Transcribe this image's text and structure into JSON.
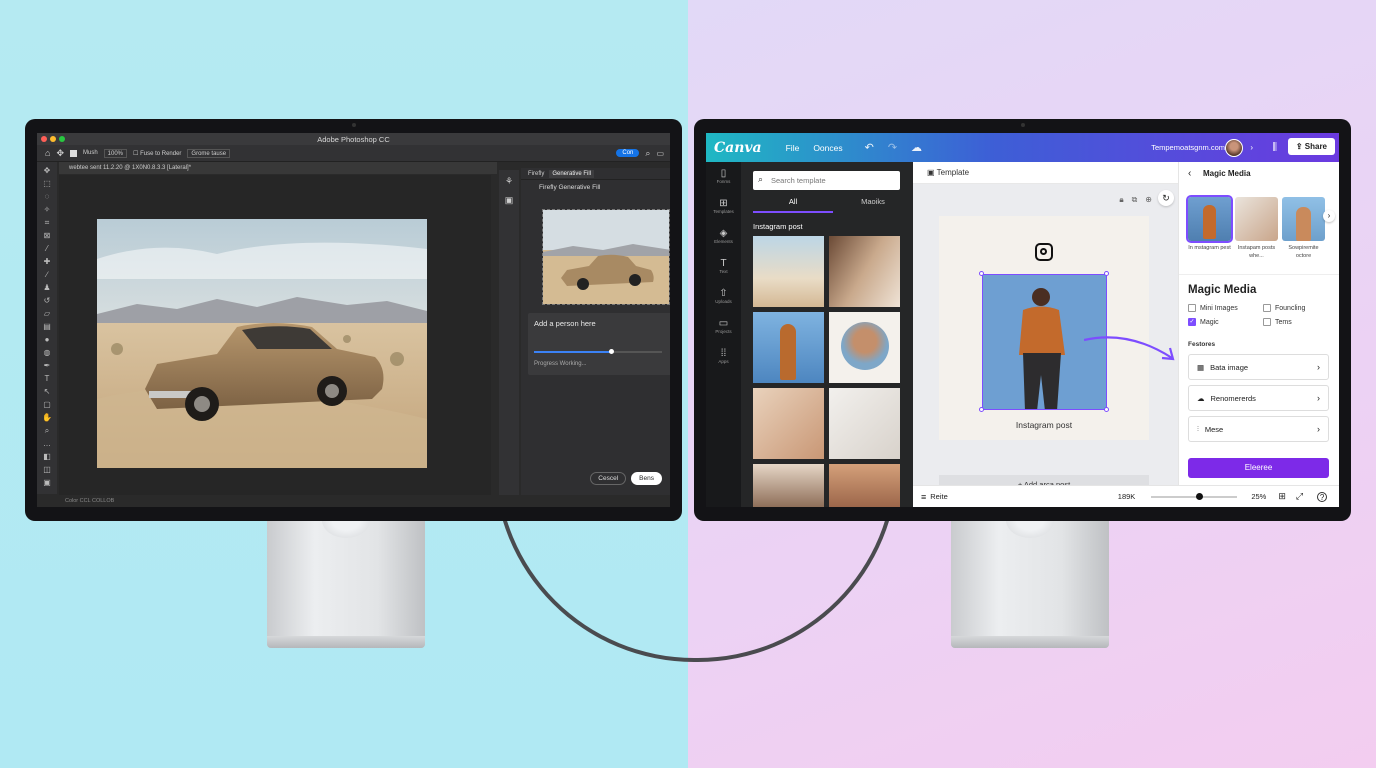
{
  "photoshop": {
    "window_title": "Adobe Photoshop CC",
    "options": {
      "mode_label": "Mush",
      "zoom": "100%",
      "checkbox_label": "Fuse to Render",
      "dropdown": "Grome tause",
      "blue_btn": "Con"
    },
    "doc_tab": "webtee sent 11.2.20 @ 1X0N0.8.3.3 [Lateral]*",
    "panel_tabs": [
      "Firefly",
      "Generative Fill"
    ],
    "panel_label": "Firefly Generative Fill",
    "prompt": "Add a person here",
    "progress": 0.6,
    "progress_text": "Progress Working...",
    "cancel": "Cescel",
    "confirm": "Bens",
    "status": "Color    CCL COLLOB"
  },
  "canva": {
    "logo": "Canva",
    "menu": [
      "File",
      "Oonces"
    ],
    "doc_name": "Tempemoatsgnm.com",
    "share": "Share",
    "rail": [
      "Fonms",
      "Templates",
      "Elements",
      "Text",
      "Uploads",
      "Projects",
      "Apps"
    ],
    "search_placeholder": "Search template",
    "tabs": [
      "All",
      "Maoiks"
    ],
    "section": "Instagram post",
    "canvas_title": "Template",
    "caption": "Instagram post",
    "add_page": "+ Add arca post",
    "bottom": {
      "left": "Reite",
      "pages": "189K",
      "zoom": 0.55,
      "zoom_label": "25%"
    },
    "right": {
      "title": "Magic Media",
      "thumbs": [
        "In mstagram pest",
        "Instapam posts whe...",
        "Sowpiremite octore"
      ],
      "heading": "Magic Media",
      "checks": [
        {
          "label": "Mini Images",
          "checked": false
        },
        {
          "label": "Founcling",
          "checked": false
        },
        {
          "label": "Magic",
          "checked": true
        },
        {
          "label": "Tems",
          "checked": false
        }
      ],
      "features_heading": "Festores",
      "features": [
        {
          "label": "Bata image",
          "icon": "image-icon"
        },
        {
          "label": "Renomererds",
          "icon": "cloud-icon"
        },
        {
          "label": "Mese",
          "icon": "sliders-icon"
        }
      ],
      "cta": "Eleeree"
    }
  },
  "colors": {
    "canva_purple": "#7d2ae8",
    "ps_blue": "#1473e6"
  }
}
